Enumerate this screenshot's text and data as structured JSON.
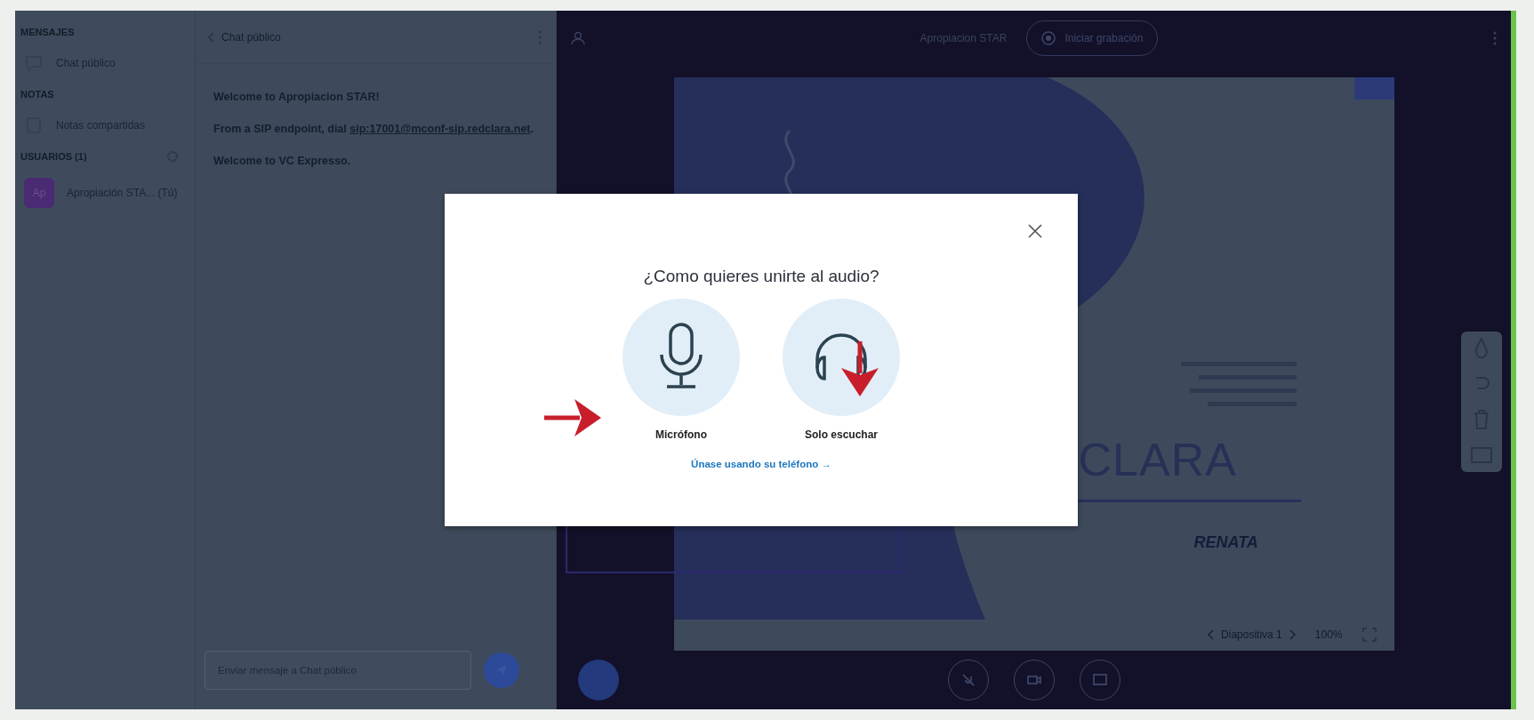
{
  "user_list": {
    "messages_heading": "MENSAJES",
    "chat_item": "Chat público",
    "notes_heading": "NOTAS",
    "notes_item": "Notas compartidas",
    "users_heading": "USUARIOS (1)",
    "users": [
      {
        "initials": "Ap",
        "name": "Apropiación STA... (Tú)"
      }
    ]
  },
  "chat": {
    "title": "Chat público",
    "messages": [
      {
        "text": "Welcome to Apropiacion STAR!"
      },
      {
        "text": "From a SIP endpoint, dial ",
        "link": "sip:17001@mconf-sip.redclara.net",
        "suffix": "."
      },
      {
        "text": "Welcome to VC Expresso."
      }
    ],
    "input": {
      "placeholder": "Enviar mensaje a Chat público"
    }
  },
  "top_bar": {
    "title": "Apropiacion STAR",
    "record_button": "Iniciar grabación"
  },
  "presentation": {
    "logo_text": "CLARA",
    "partner_logo": "RENATA",
    "slide_label": "Diapositiva 1",
    "zoom": "100%"
  },
  "modal": {
    "title": "¿Como quieres unirte al audio?",
    "options": [
      {
        "kind": "microphone",
        "label": "Micrófono"
      },
      {
        "kind": "listen",
        "label": "Solo escuchar"
      }
    ],
    "phone_link": "Únase usando su teléfono →"
  }
}
